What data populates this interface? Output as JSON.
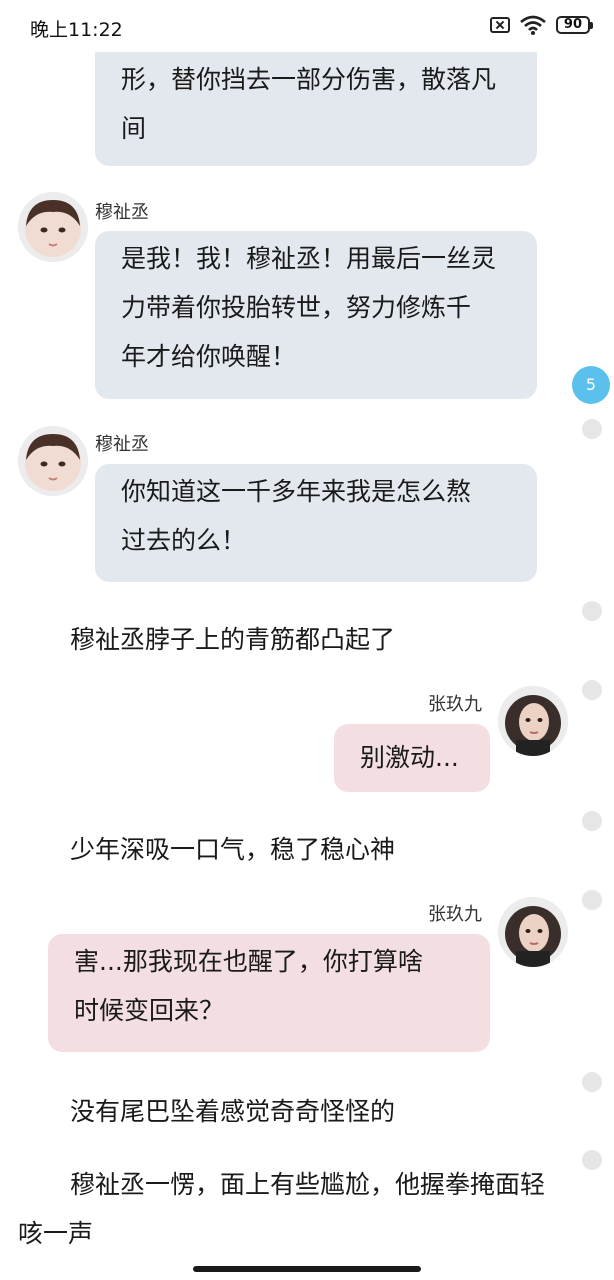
{
  "status_bar": {
    "time": "晚上11:22",
    "battery": "90",
    "icons": [
      "sim-off-icon",
      "wifi-icon",
      "battery-icon"
    ]
  },
  "messages": {
    "m1": {
      "text_line1": "形，替你挡去一部分伤害，散落凡",
      "text_line2": "间"
    },
    "m2": {
      "sender": "穆祉丞",
      "text_line1": "是我！我！穆祉丞！用最后一丝灵",
      "text_line2": "力带着你投胎转世，努力修炼千",
      "text_line3": "年才给你唤醒！"
    },
    "m3": {
      "sender": "穆祉丞",
      "text_line1": "你知道这一千多年来我是怎么熬",
      "text_line2": "过去的么！"
    },
    "n1": "穆祉丞脖子上的青筋都凸起了",
    "m4": {
      "sender": "张玖九",
      "text": "别激动..."
    },
    "n2": "少年深吸一口气，稳了稳心神",
    "m5": {
      "sender": "张玖九",
      "text_line1": "害...那我现在也醒了，你打算啥",
      "text_line2": "时候变回来？"
    },
    "n3": "没有尾巴坠着感觉奇奇怪怪的",
    "n4_line1": "穆祉丞一愣，面上有些尴尬，他握拳掩面轻",
    "n4_line2": "咳一声"
  },
  "side": {
    "badge_count": "5"
  },
  "colors": {
    "left_bubble": "#e3e8ee",
    "right_bubble": "#f3dfe1",
    "badge": "#5bc0eb"
  }
}
